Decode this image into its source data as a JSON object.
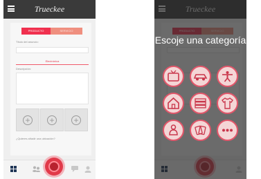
{
  "app": {
    "title": "Trueckee"
  },
  "form": {
    "tab_product": "PRODUCTO",
    "tab_service": "SERVICIO",
    "title_label": "Título del anuncio:",
    "category_value": "Electrónica",
    "description_label": "Descripción:",
    "location_prompt": "¿Quieres añadir una ubicación?"
  },
  "category_modal": {
    "title": "Escoje una categoría"
  },
  "colors": {
    "accent": "#f0304e",
    "accent_light": "#ef8f7f",
    "topbar": "#3a3a3a",
    "fab": "#e13a4a"
  },
  "icons": {
    "categories": [
      "tv-icon",
      "car-icon",
      "fitness-icon",
      "home-icon",
      "books-icon",
      "clothing-icon",
      "baby-icon",
      "cards-icon",
      "more-icon"
    ],
    "bottom_nav": [
      "grid-icon",
      "users-icon",
      "chat-icon",
      "profile-icon"
    ]
  }
}
